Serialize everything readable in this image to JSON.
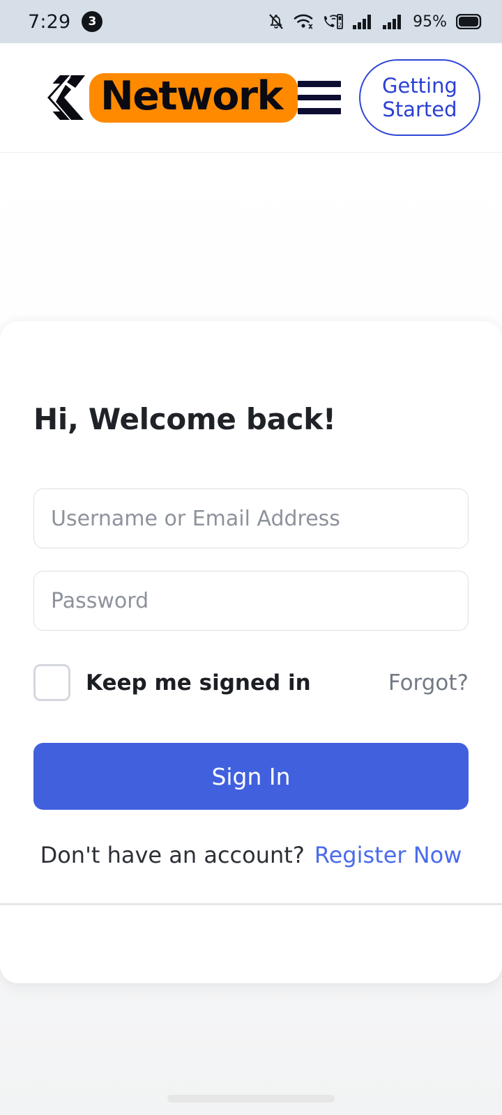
{
  "status_bar": {
    "time": "7:29",
    "notification_count": "3",
    "battery_percent": "95%",
    "icons": [
      "bell-slash-icon",
      "wifi-icon",
      "volte-call-icon",
      "signal-bars-sim1-icon",
      "signal-bars-sim2-icon",
      "battery-icon"
    ],
    "background_color": "#d6dfe8"
  },
  "header": {
    "logo_mark": "cx-chevron-logo-icon",
    "brand_name": "Network",
    "brand_pill_color": "#FF8A00",
    "menu_icon": "hamburger-menu-icon",
    "getting_started_label": "Getting Started",
    "getting_started_color": "#2b3fd4"
  },
  "auth": {
    "title": "Hi, Welcome back!",
    "username": {
      "value": "",
      "placeholder": "Username or Email Address"
    },
    "password": {
      "value": "",
      "placeholder": "Password"
    },
    "keep_signed_in_label": "Keep me signed in",
    "keep_signed_in_checked": false,
    "forgot_label": "Forgot?",
    "submit_label": "Sign In",
    "no_account_text": "Don't have an account?",
    "register_label": "Register Now",
    "primary_button_color": "#4160dd",
    "link_color": "#4a6bea"
  }
}
